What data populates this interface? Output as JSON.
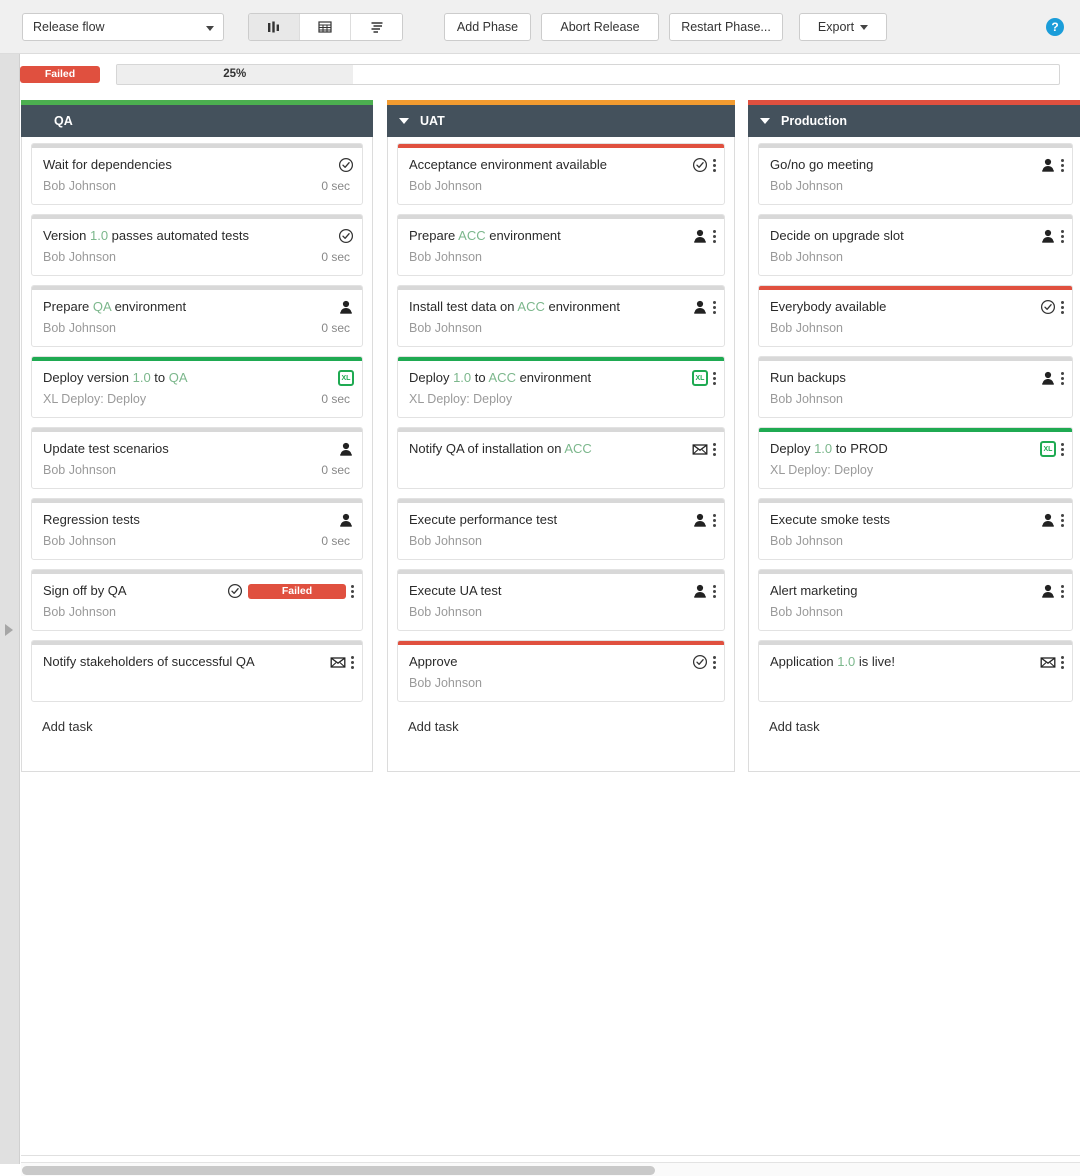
{
  "toolbar": {
    "release_flow_label": "Release flow",
    "view_kanban_icon": "kanban-columns-icon",
    "view_table_icon": "grid-table-icon",
    "view_list_icon": "list-align-icon",
    "add_phase_label": "Add Phase",
    "abort_release_label": "Abort Release",
    "restart_phase_label": "Restart Phase...",
    "export_label": "Export",
    "help_glyph": "?"
  },
  "status": {
    "badge_label": "Failed",
    "badge_color": "#e0503f",
    "progress_percent": 25,
    "progress_label": "25%"
  },
  "board": {
    "add_task_label": "Add task",
    "phases": [
      {
        "name": "QA",
        "accent_color": "#4caf50",
        "collapsible": false,
        "tasks": [
          {
            "title_parts": [
              {
                "t": "Wait for dependencies",
                "var": false
              }
            ],
            "owner": "Bob Johnson",
            "duration": "0 sec",
            "strip_color": "#d8d8d8",
            "icons": [
              "check-circle-icon"
            ],
            "kebab": false
          },
          {
            "title_parts": [
              {
                "t": "Version ",
                "var": false
              },
              {
                "t": "1.0",
                "var": true
              },
              {
                "t": " passes automated tests",
                "var": false
              }
            ],
            "owner": "Bob Johnson",
            "duration": "0 sec",
            "strip_color": "#d8d8d8",
            "icons": [
              "check-circle-icon"
            ],
            "kebab": false
          },
          {
            "title_parts": [
              {
                "t": "Prepare ",
                "var": false
              },
              {
                "t": "QA",
                "var": true
              },
              {
                "t": " environment",
                "var": false
              }
            ],
            "owner": "Bob Johnson",
            "duration": "0 sec",
            "strip_color": "#d8d8d8",
            "icons": [
              "person-icon"
            ],
            "kebab": false
          },
          {
            "title_parts": [
              {
                "t": "Deploy version ",
                "var": false
              },
              {
                "t": "1.0",
                "var": true
              },
              {
                "t": " to ",
                "var": false
              },
              {
                "t": "QA",
                "var": true
              }
            ],
            "owner": "XL Deploy: Deploy",
            "duration": "0 sec",
            "strip_color": "#1faa52",
            "icons": [
              "xl-deploy-icon"
            ],
            "kebab": false
          },
          {
            "title_parts": [
              {
                "t": "Update test scenarios",
                "var": false
              }
            ],
            "owner": "Bob Johnson",
            "duration": "0 sec",
            "strip_color": "#d8d8d8",
            "icons": [
              "person-icon"
            ],
            "kebab": false
          },
          {
            "title_parts": [
              {
                "t": "Regression tests",
                "var": false
              }
            ],
            "owner": "Bob Johnson",
            "duration": "0 sec",
            "strip_color": "#d8d8d8",
            "icons": [
              "person-icon"
            ],
            "kebab": false
          },
          {
            "title_parts": [
              {
                "t": "Sign off by QA",
                "var": false
              }
            ],
            "owner": "Bob Johnson",
            "duration": "",
            "strip_color": "#d8d8d8",
            "icons": [
              "check-circle-icon",
              "failed-badge"
            ],
            "badge_label": "Failed",
            "kebab": true
          },
          {
            "title_parts": [
              {
                "t": "Notify stakeholders of successful QA",
                "var": false
              }
            ],
            "owner": "",
            "duration": "",
            "strip_color": "#d8d8d8",
            "icons": [
              "mail-icon"
            ],
            "kebab": true
          }
        ]
      },
      {
        "name": "UAT",
        "accent_color": "#f29b30",
        "collapsible": true,
        "tasks": [
          {
            "title_parts": [
              {
                "t": "Acceptance environment available",
                "var": false
              }
            ],
            "owner": "Bob Johnson",
            "duration": "",
            "strip_color": "#e0503f",
            "icons": [
              "check-circle-icon"
            ],
            "kebab": true
          },
          {
            "title_parts": [
              {
                "t": "Prepare ",
                "var": false
              },
              {
                "t": "ACC",
                "var": true
              },
              {
                "t": " environment",
                "var": false
              }
            ],
            "owner": "Bob Johnson",
            "duration": "",
            "strip_color": "#d8d8d8",
            "icons": [
              "person-icon"
            ],
            "kebab": true
          },
          {
            "title_parts": [
              {
                "t": "Install test data on ",
                "var": false
              },
              {
                "t": "ACC",
                "var": true
              },
              {
                "t": " environment",
                "var": false
              }
            ],
            "owner": "Bob Johnson",
            "duration": "",
            "strip_color": "#d8d8d8",
            "icons": [
              "person-icon"
            ],
            "kebab": true
          },
          {
            "title_parts": [
              {
                "t": "Deploy ",
                "var": false
              },
              {
                "t": "1.0",
                "var": true
              },
              {
                "t": " to ",
                "var": false
              },
              {
                "t": "ACC",
                "var": true
              },
              {
                "t": " environment",
                "var": false
              }
            ],
            "owner": "XL Deploy: Deploy",
            "duration": "",
            "strip_color": "#1faa52",
            "icons": [
              "xl-deploy-icon"
            ],
            "kebab": true
          },
          {
            "title_parts": [
              {
                "t": "Notify QA of installation on ",
                "var": false
              },
              {
                "t": "ACC",
                "var": true
              }
            ],
            "owner": "",
            "duration": "",
            "strip_color": "#d8d8d8",
            "icons": [
              "mail-icon"
            ],
            "kebab": true
          },
          {
            "title_parts": [
              {
                "t": "Execute performance test",
                "var": false
              }
            ],
            "owner": "Bob Johnson",
            "duration": "",
            "strip_color": "#d8d8d8",
            "icons": [
              "person-icon"
            ],
            "kebab": true
          },
          {
            "title_parts": [
              {
                "t": "Execute UA test",
                "var": false
              }
            ],
            "owner": "Bob Johnson",
            "duration": "",
            "strip_color": "#d8d8d8",
            "icons": [
              "person-icon"
            ],
            "kebab": true
          },
          {
            "title_parts": [
              {
                "t": "Approve",
                "var": false
              }
            ],
            "owner": "Bob Johnson",
            "duration": "",
            "strip_color": "#e0503f",
            "icons": [
              "check-circle-icon"
            ],
            "kebab": true
          }
        ]
      },
      {
        "name": "Production",
        "accent_color": "#e0503f",
        "collapsible": true,
        "tasks": [
          {
            "title_parts": [
              {
                "t": "Go/no go meeting",
                "var": false
              }
            ],
            "owner": "Bob Johnson",
            "duration": "",
            "strip_color": "#d8d8d8",
            "icons": [
              "person-icon"
            ],
            "kebab": true
          },
          {
            "title_parts": [
              {
                "t": "Decide on upgrade slot",
                "var": false
              }
            ],
            "owner": "Bob Johnson",
            "duration": "",
            "strip_color": "#d8d8d8",
            "icons": [
              "person-icon"
            ],
            "kebab": true
          },
          {
            "title_parts": [
              {
                "t": "Everybody available",
                "var": false
              }
            ],
            "owner": "Bob Johnson",
            "duration": "",
            "strip_color": "#e0503f",
            "icons": [
              "check-circle-icon"
            ],
            "kebab": true
          },
          {
            "title_parts": [
              {
                "t": "Run backups",
                "var": false
              }
            ],
            "owner": "Bob Johnson",
            "duration": "",
            "strip_color": "#d8d8d8",
            "icons": [
              "person-icon"
            ],
            "kebab": true
          },
          {
            "title_parts": [
              {
                "t": "Deploy ",
                "var": false
              },
              {
                "t": "1.0",
                "var": true
              },
              {
                "t": " to PROD",
                "var": false
              }
            ],
            "owner": "XL Deploy: Deploy",
            "duration": "",
            "strip_color": "#1faa52",
            "icons": [
              "xl-deploy-icon"
            ],
            "kebab": true
          },
          {
            "title_parts": [
              {
                "t": "Execute smoke tests",
                "var": false
              }
            ],
            "owner": "Bob Johnson",
            "duration": "",
            "strip_color": "#d8d8d8",
            "icons": [
              "person-icon"
            ],
            "kebab": true
          },
          {
            "title_parts": [
              {
                "t": "Alert marketing",
                "var": false
              }
            ],
            "owner": "Bob Johnson",
            "duration": "",
            "strip_color": "#d8d8d8",
            "icons": [
              "person-icon"
            ],
            "kebab": true
          },
          {
            "title_parts": [
              {
                "t": "Application ",
                "var": false
              },
              {
                "t": "1.0",
                "var": true
              },
              {
                "t": " is live!",
                "var": false
              }
            ],
            "owner": "",
            "duration": "",
            "strip_color": "#d8d8d8",
            "icons": [
              "mail-icon"
            ],
            "kebab": true
          }
        ]
      }
    ]
  }
}
